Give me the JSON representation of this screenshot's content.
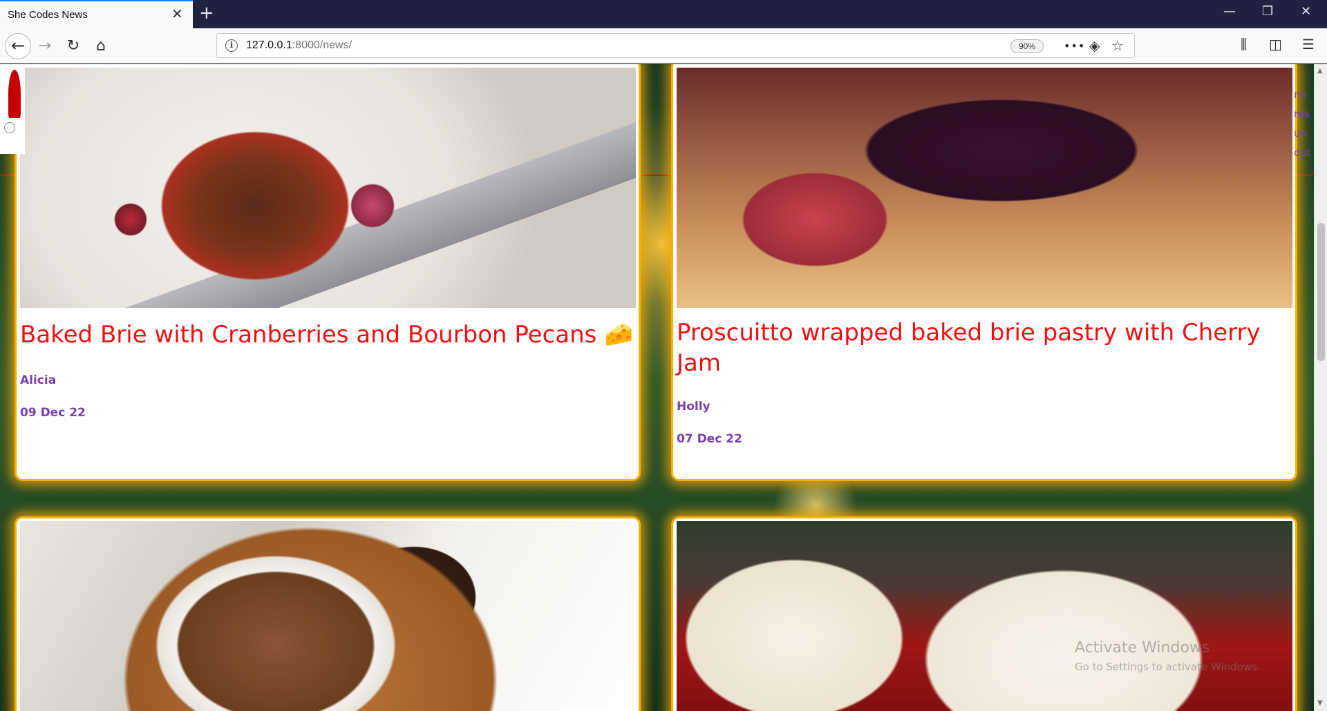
{
  "browser": {
    "tab_title": "She Codes News",
    "tab_close": "✕",
    "new_tab": "+",
    "window_controls": {
      "minimize": "—",
      "restore": "❐",
      "close": "✕"
    },
    "nav": {
      "back": "←",
      "forward": "→",
      "reload": "↻",
      "home": "⌂"
    },
    "url_host": "127.0.0.1",
    "url_path": ":8000/news/",
    "zoom": "90%",
    "url_icons": {
      "more": "•••",
      "pocket": "◈",
      "bookmark": "☆"
    },
    "toolbar_icons": {
      "library": "⫼",
      "sidebar": "◫",
      "menu": "☰"
    }
  },
  "articles": [
    {
      "title": "Baked Brie with Cranberries and Bourbon Pecans 🧀",
      "author": "Alicia",
      "date": "09 Dec 22",
      "image": "baked-brie-photo"
    },
    {
      "title": "Proscuitto wrapped baked brie pastry with Cherry Jam",
      "author": "Holly",
      "date": "07 Dec 22",
      "image": "prosciutto-pastry-photo"
    },
    {
      "title": "",
      "author": "",
      "date": "",
      "image": "hot-chocolate-brownie-photo"
    },
    {
      "title": "",
      "author": "",
      "date": "",
      "image": "red-velvet-cupcake-photo"
    }
  ],
  "side_letters": [
    "ne",
    "res",
    "un",
    "out"
  ],
  "watermark": {
    "line1": "Activate Windows",
    "line2": "Go to Settings to activate Windows."
  },
  "colors": {
    "title": "#ee1111",
    "meta": "#7a3fb0",
    "card_border": "#f3b300",
    "tab_accent": "#0a84ff"
  }
}
